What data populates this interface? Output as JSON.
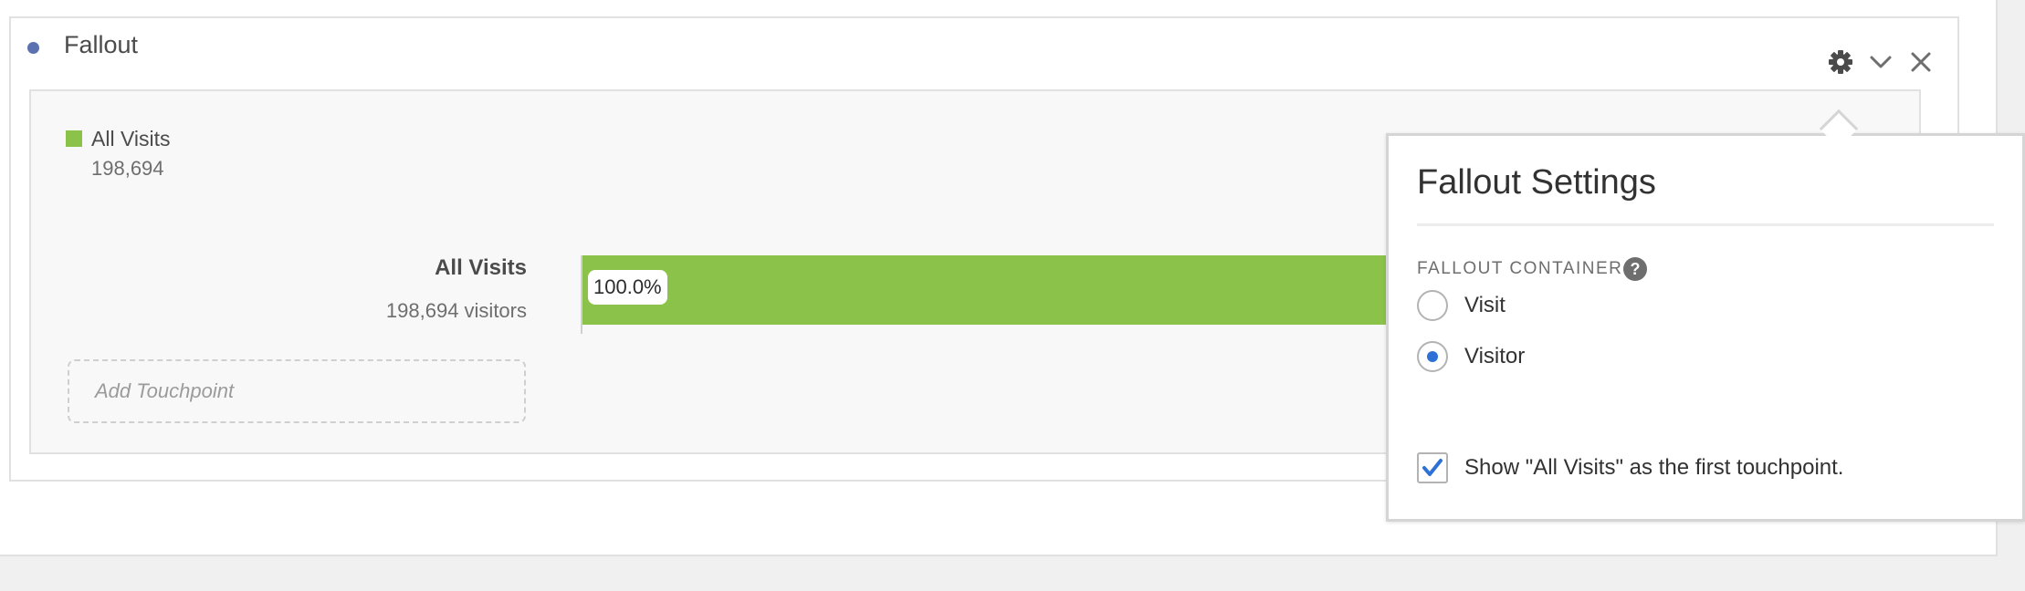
{
  "panel": {
    "title": "Fallout",
    "accent_color": "#5b71b0",
    "header_icons": [
      "gear-icon",
      "chevron-down-icon",
      "close-icon"
    ]
  },
  "legend": {
    "label": "All Visits",
    "value": "198,694",
    "color": "#8bc34a"
  },
  "touchpoints": [
    {
      "label": "All Visits",
      "sub": "198,694 visitors",
      "percent_label": "100.0%",
      "percent": 100.0
    }
  ],
  "add_touchpoint_placeholder": "Add Touchpoint",
  "settings": {
    "title": "Fallout Settings",
    "section_label": "FALLOUT CONTAINER",
    "help_glyph": "?",
    "options": [
      {
        "label": "Visit",
        "selected": false
      },
      {
        "label": "Visitor",
        "selected": true
      }
    ],
    "checkbox": {
      "label": "Show \"All Visits\" as the first touchpoint.",
      "checked": true
    }
  }
}
